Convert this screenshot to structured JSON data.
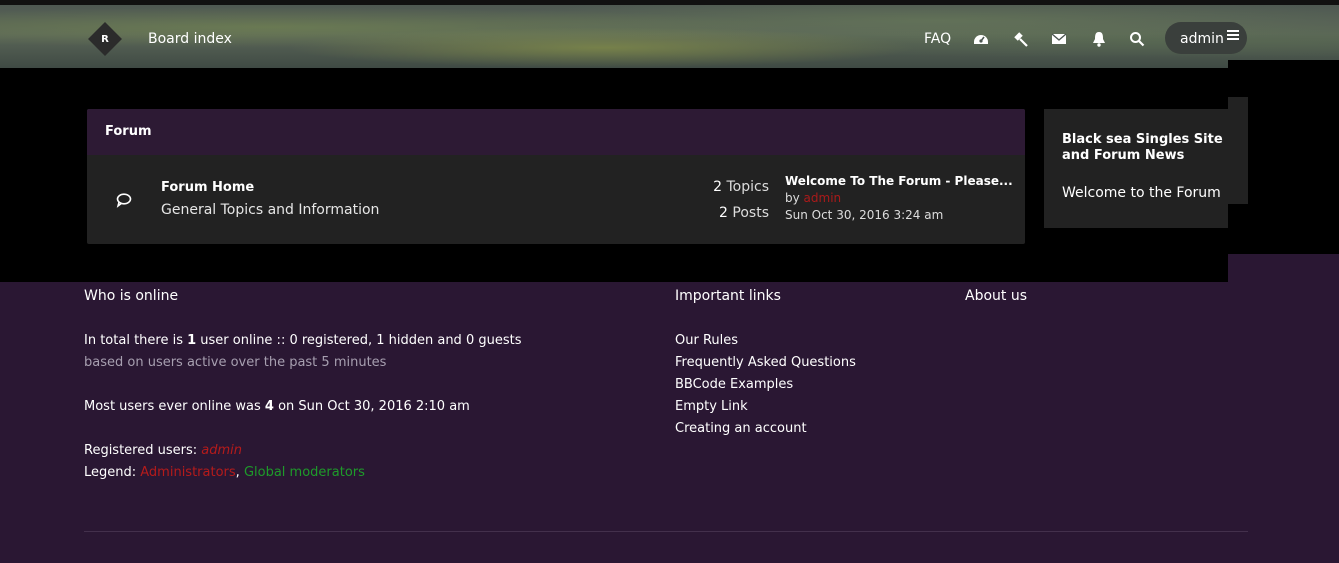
{
  "header": {
    "logo_letter": "R",
    "board_index": "Board index",
    "faq": "FAQ",
    "username": "admin",
    "icons": [
      "dashboard-icon",
      "hammer-icon",
      "envelope-icon",
      "bell-icon",
      "search-icon",
      "hamburger-menu-icon"
    ]
  },
  "forum": {
    "header": "Forum",
    "row": {
      "name": "Forum Home",
      "description": "General Topics and Information",
      "topics_count": "2",
      "topics_label": "Topics",
      "posts_count": "2",
      "posts_label": "Posts",
      "last_post_title": "Welcome To The Forum - Please...",
      "last_post_by": "by",
      "last_post_author": "admin",
      "last_post_date": "Sun Oct 30, 2016 3:24 am"
    }
  },
  "sidebar": {
    "title": "Black sea Singles Site and Forum News",
    "text": "Welcome to the Forum"
  },
  "footer": {
    "who_online": {
      "heading": "Who is online",
      "total_prefix": "In total there is ",
      "total_count": "1",
      "total_suffix": " user online :: 0 registered, 1 hidden and 0 guests",
      "based_on": "based on users active over the past 5 minutes",
      "most_prefix": "Most users ever online was ",
      "most_count": "4",
      "most_suffix": " on Sun Oct 30, 2016 2:10 am",
      "registered_label": "Registered users: ",
      "registered_user": "admin",
      "legend_label": "Legend: ",
      "legend_admins": "Administrators",
      "legend_sep": ", ",
      "legend_mods": "Global moderators"
    },
    "important_links": {
      "heading": "Important links",
      "items": [
        "Our Rules",
        "Frequently Asked Questions",
        "BBCode Examples",
        "Empty Link",
        "Creating an account"
      ]
    },
    "about": {
      "heading": "About us"
    }
  },
  "colors": {
    "purple_bg": "#2a1733",
    "panel_header": "#2d1a34",
    "panel": "#222222",
    "admin_red": "#b51b1b",
    "moderator_green": "#1e9b2a"
  }
}
